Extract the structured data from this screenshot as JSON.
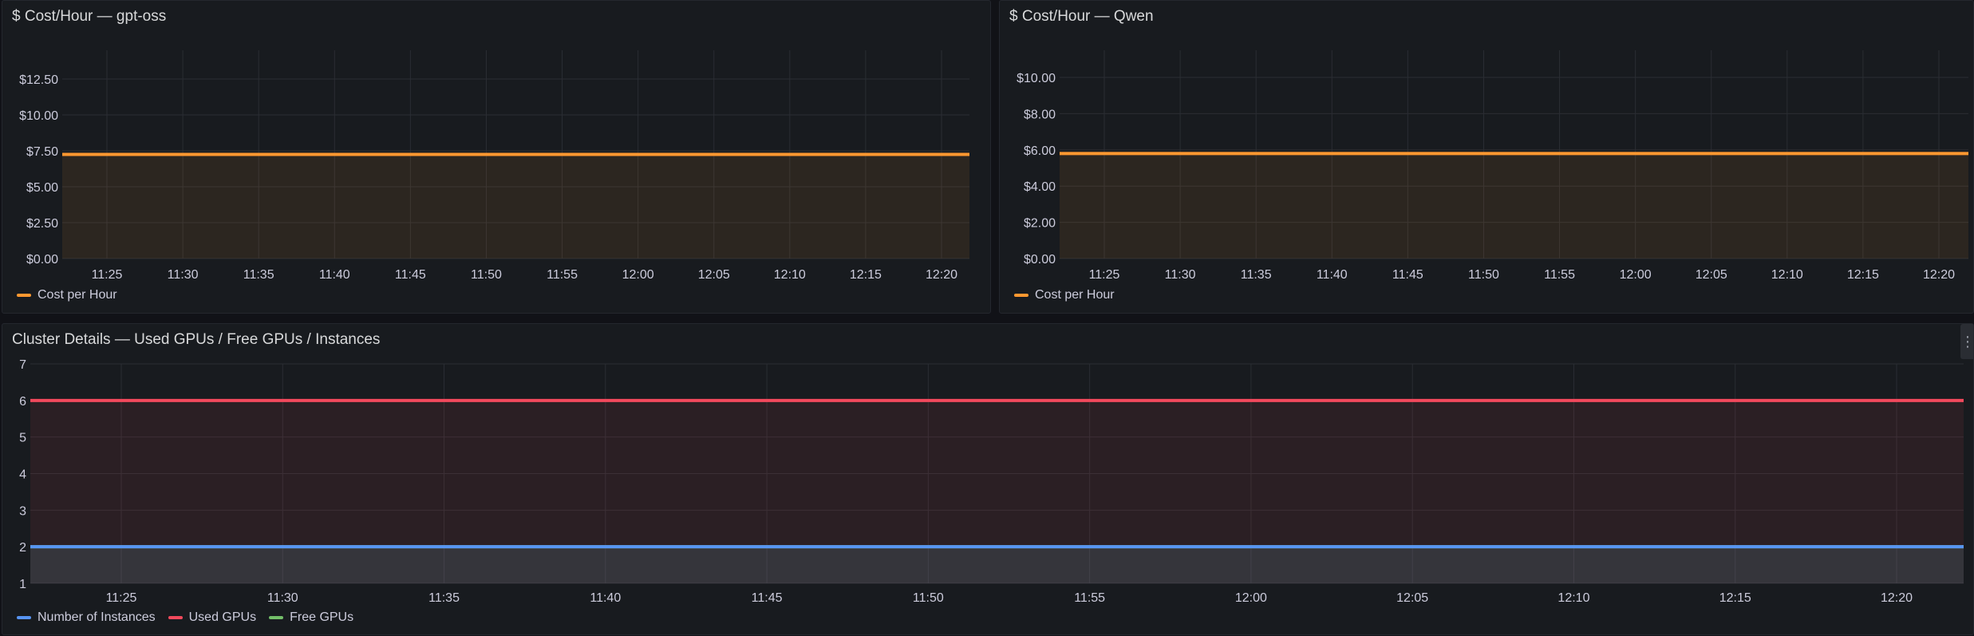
{
  "panels": [
    {
      "title": "$ Cost/Hour — gpt-oss",
      "chart_data": {
        "type": "area",
        "title": "$ Cost/Hour — gpt-oss",
        "x": [
          "11:25",
          "11:30",
          "11:35",
          "11:40",
          "11:45",
          "11:50",
          "11:55",
          "12:00",
          "12:05",
          "12:10",
          "12:15",
          "12:20"
        ],
        "y_ticks": [
          "$0.00",
          "$2.50",
          "$5.00",
          "$7.50",
          "$10.00",
          "$12.50"
        ],
        "ylim": [
          0,
          14.5
        ],
        "series": [
          {
            "name": "Cost per Hour",
            "color": "#ff9830",
            "values": [
              7.25,
              7.25,
              7.25,
              7.25,
              7.25,
              7.25,
              7.25,
              7.25,
              7.25,
              7.25,
              7.25,
              7.25
            ]
          }
        ],
        "grid": true,
        "legend": "bottom-left"
      }
    },
    {
      "title": "$ Cost/Hour — Qwen",
      "chart_data": {
        "type": "area",
        "title": "$ Cost/Hour — Qwen",
        "x": [
          "11:25",
          "11:30",
          "11:35",
          "11:40",
          "11:45",
          "11:50",
          "11:55",
          "12:00",
          "12:05",
          "12:10",
          "12:15",
          "12:20"
        ],
        "y_ticks": [
          "$0.00",
          "$2.00",
          "$4.00",
          "$6.00",
          "$8.00",
          "$10.00"
        ],
        "ylim": [
          0,
          11.5
        ],
        "series": [
          {
            "name": "Cost per Hour",
            "color": "#ff9830",
            "values": [
              5.8,
              5.8,
              5.8,
              5.8,
              5.8,
              5.8,
              5.8,
              5.8,
              5.8,
              5.8,
              5.8,
              5.8
            ]
          }
        ],
        "grid": true,
        "legend": "bottom-left"
      }
    },
    {
      "title": "Cluster Details — Used GPUs / Free GPUs / Instances",
      "chart_data": {
        "type": "area",
        "title": "Cluster Details — Used GPUs / Free GPUs / Instances",
        "x": [
          "11:25",
          "11:30",
          "11:35",
          "11:40",
          "11:45",
          "11:50",
          "11:55",
          "12:00",
          "12:05",
          "12:10",
          "12:15",
          "12:20"
        ],
        "y_ticks": [
          "1",
          "2",
          "3",
          "4",
          "5",
          "6",
          "7"
        ],
        "ylim": [
          1,
          7
        ],
        "series": [
          {
            "name": "Number of Instances",
            "color": "#5794f2",
            "values": [
              2,
              2,
              2,
              2,
              2,
              2,
              2,
              2,
              2,
              2,
              2,
              2
            ]
          },
          {
            "name": "Used GPUs",
            "color": "#f2495c",
            "values": [
              6,
              6,
              6,
              6,
              6,
              6,
              6,
              6,
              6,
              6,
              6,
              6
            ]
          },
          {
            "name": "Free GPUs",
            "color": "#73bf69",
            "values": [
              2,
              2,
              2,
              2,
              2,
              2,
              2,
              2,
              2,
              2,
              2,
              2
            ]
          }
        ],
        "grid": true,
        "legend": "bottom-left"
      }
    }
  ],
  "menu_handle_glyph": "⋮"
}
